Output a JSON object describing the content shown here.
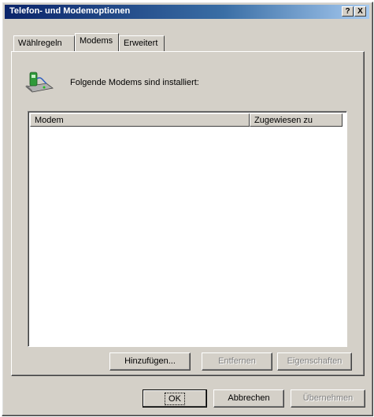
{
  "window": {
    "title": "Telefon- und Modemoptionen"
  },
  "titlebar": {
    "help_label": "?",
    "close_label": "X"
  },
  "tabs": [
    {
      "label": "Wählregeln",
      "active": false
    },
    {
      "label": "Modems",
      "active": true
    },
    {
      "label": "Erweitert",
      "active": false
    }
  ],
  "panel": {
    "caption": "Folgende Modems sind installiert:",
    "icon": "modem-icon"
  },
  "list": {
    "columns": [
      "Modem",
      "Zugewiesen zu"
    ],
    "rows": []
  },
  "panel_buttons": {
    "add": "Hinzufügen...",
    "remove": "Entfernen",
    "properties": "Eigenschaften"
  },
  "dialog_buttons": {
    "ok": "OK",
    "cancel": "Abbrechen",
    "apply": "Übernehmen"
  }
}
